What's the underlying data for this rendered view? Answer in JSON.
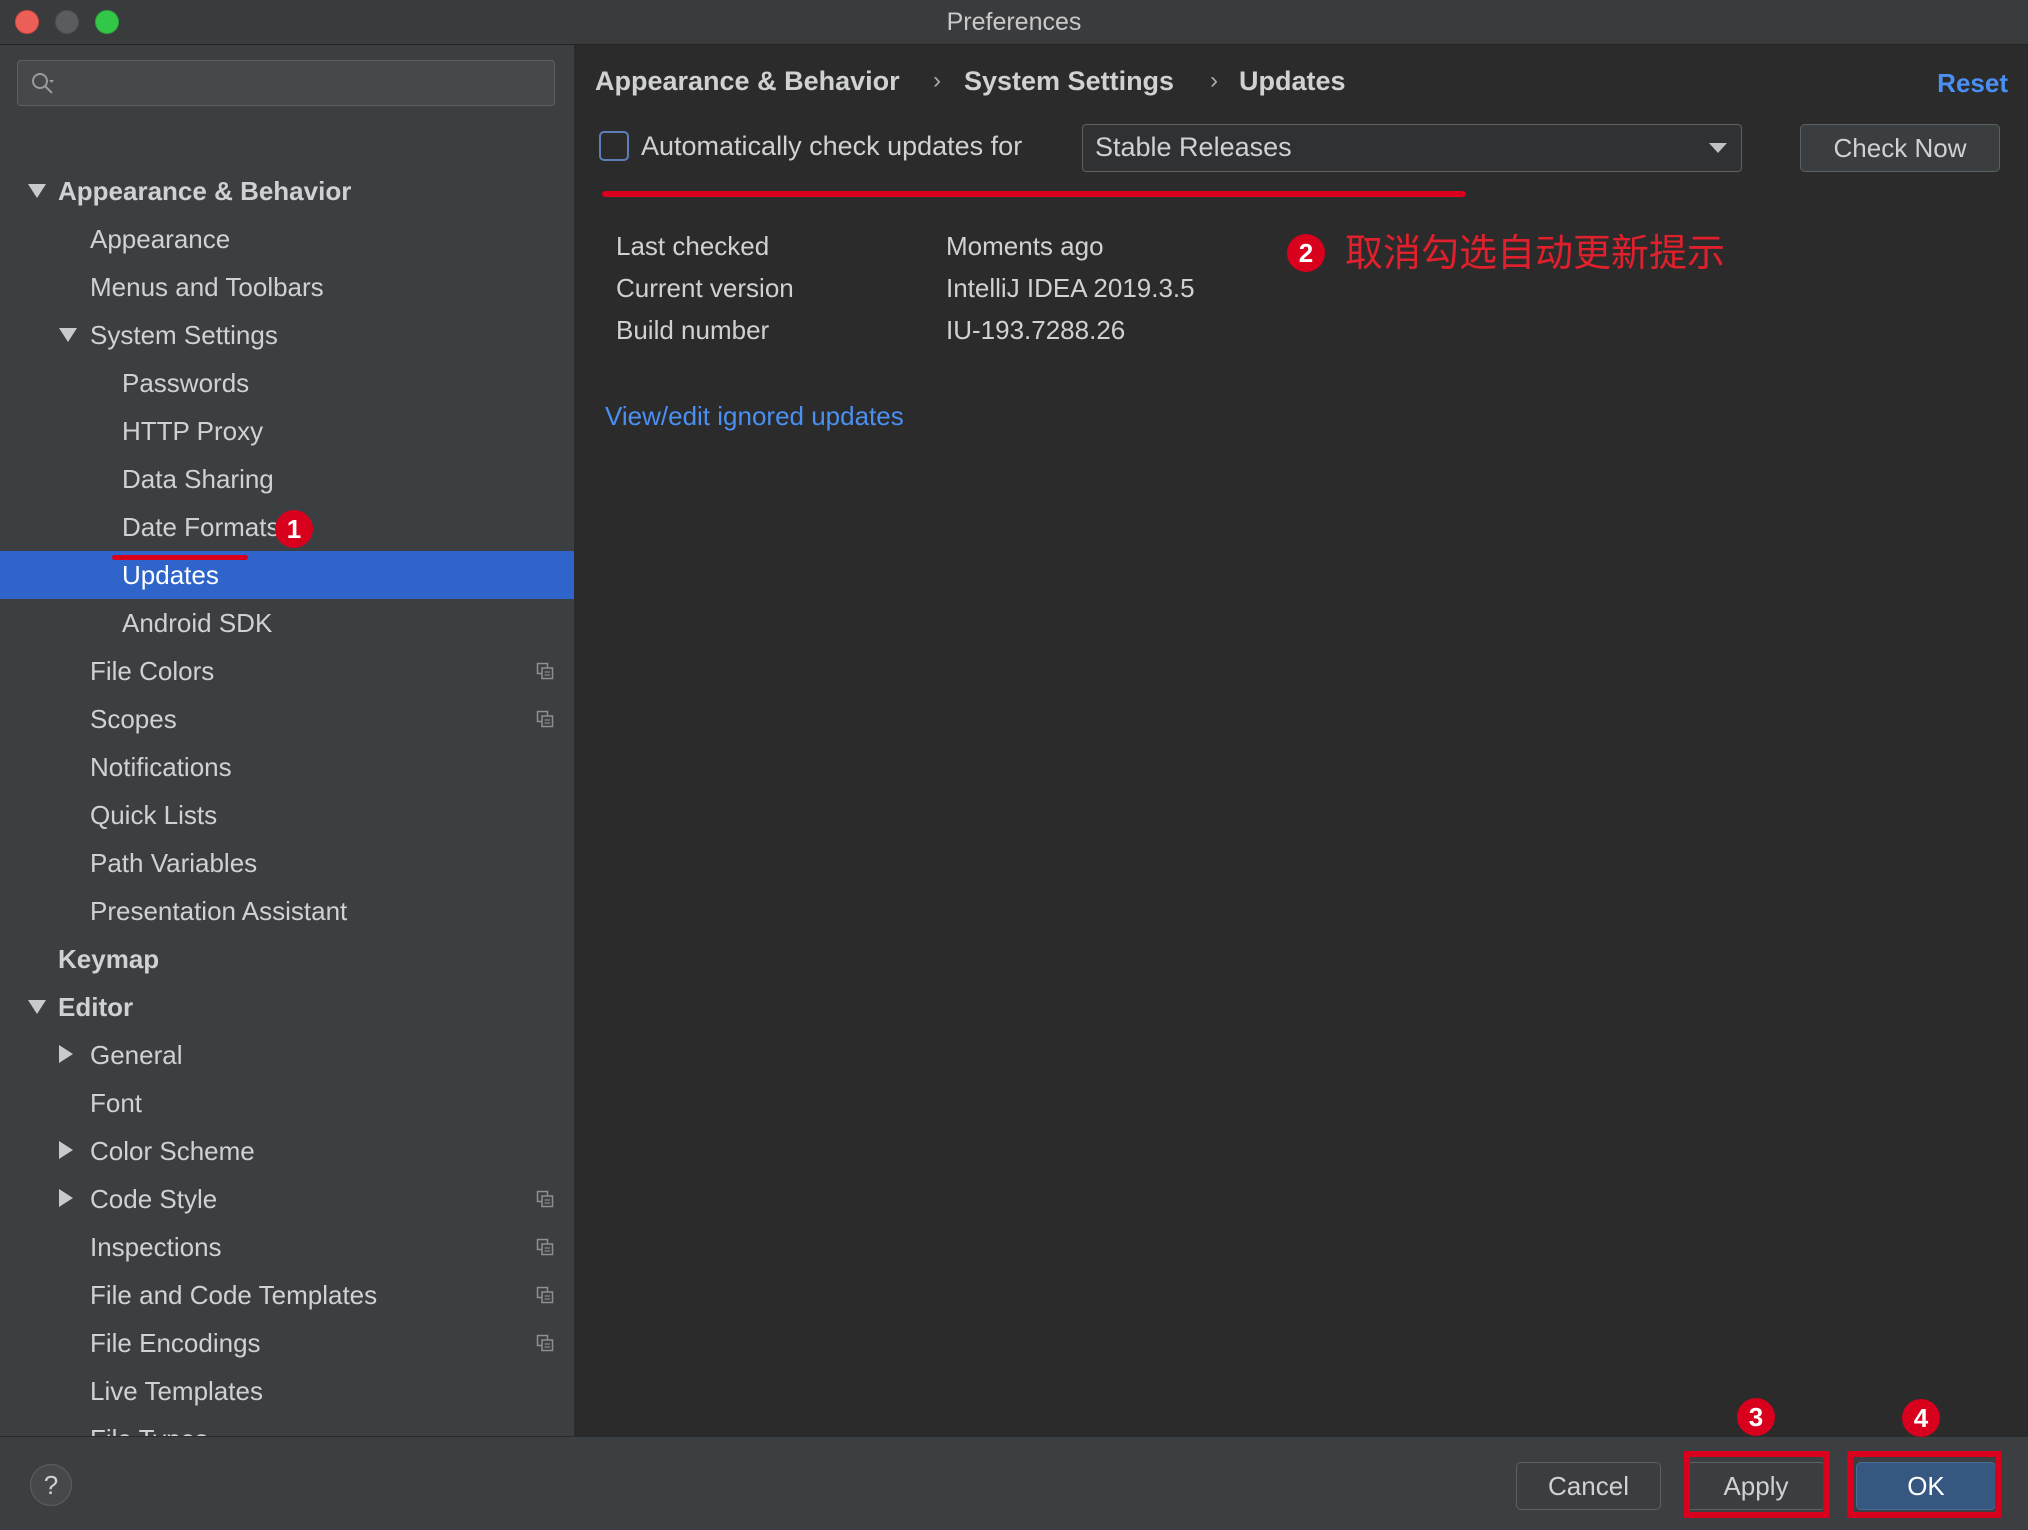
{
  "window": {
    "title": "Preferences"
  },
  "sidebar": {
    "search_placeholder": "",
    "items": [
      {
        "label": "Appearance & Behavior",
        "expander": "expanded"
      },
      {
        "label": "Appearance"
      },
      {
        "label": "Menus and Toolbars"
      },
      {
        "label": "System Settings",
        "expander": "expanded"
      },
      {
        "label": "Passwords"
      },
      {
        "label": "HTTP Proxy"
      },
      {
        "label": "Data Sharing"
      },
      {
        "label": "Date Formats"
      },
      {
        "label": "Updates",
        "selected": true
      },
      {
        "label": "Android SDK"
      },
      {
        "label": "File Colors",
        "icon": "copy-settings-icon"
      },
      {
        "label": "Scopes",
        "icon": "copy-settings-icon"
      },
      {
        "label": "Notifications"
      },
      {
        "label": "Quick Lists"
      },
      {
        "label": "Path Variables"
      },
      {
        "label": "Presentation Assistant"
      },
      {
        "label": "Keymap"
      },
      {
        "label": "Editor",
        "expander": "expanded"
      },
      {
        "label": "General",
        "expander": "collapsed"
      },
      {
        "label": "Font"
      },
      {
        "label": "Color Scheme",
        "expander": "collapsed"
      },
      {
        "label": "Code Style",
        "expander": "collapsed",
        "icon": "copy-settings-icon"
      },
      {
        "label": "Inspections",
        "icon": "copy-settings-icon"
      },
      {
        "label": "File and Code Templates",
        "icon": "copy-settings-icon"
      },
      {
        "label": "File Encodings",
        "icon": "copy-settings-icon"
      },
      {
        "label": "Live Templates"
      },
      {
        "label": "File Types"
      }
    ]
  },
  "breadcrumb": {
    "items": [
      "Appearance & Behavior",
      "System Settings",
      "Updates"
    ],
    "separator": "›",
    "reset_label": "Reset"
  },
  "updates": {
    "auto_check_label": "Automatically check updates for",
    "auto_check_checked": false,
    "channel_selected": "Stable Releases",
    "check_now_label": "Check Now",
    "info": [
      {
        "label": "Last checked",
        "value": "Moments ago"
      },
      {
        "label": "Current version",
        "value": "IntelliJ IDEA 2019.3.5"
      },
      {
        "label": "Build number",
        "value": "IU-193.7288.26"
      }
    ],
    "ignored_link": "View/edit ignored updates"
  },
  "footer": {
    "help_label": "?",
    "cancel_label": "Cancel",
    "apply_label": "Apply",
    "ok_label": "OK"
  },
  "annotations": {
    "badges": [
      "1",
      "2",
      "3",
      "4"
    ],
    "note": "取消勾选自动更新提示",
    "color": "#d8001c"
  },
  "colors": {
    "selection": "#2f65ca",
    "link": "#4a8ff2",
    "sidebar_bg": "#3c3f41",
    "main_bg": "#2b2b2b"
  }
}
